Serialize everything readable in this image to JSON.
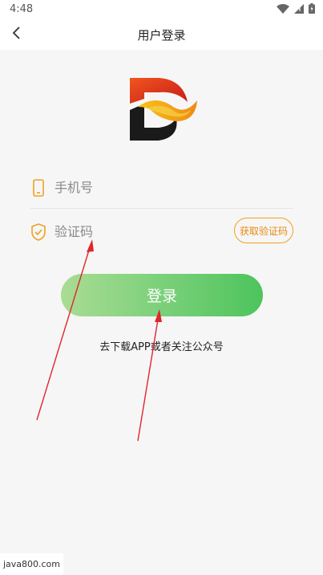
{
  "status_bar": {
    "time": "4:48",
    "icons": [
      "wifi-icon",
      "cellular-signal-icon",
      "battery-icon"
    ]
  },
  "app_bar": {
    "title": "用户登录",
    "back_icon": "chevron-left-icon"
  },
  "logo": {
    "letter": "D",
    "colors": [
      "#1a1a1a",
      "#d9261c",
      "#f5a11c"
    ]
  },
  "form": {
    "phone_placeholder": "手机号",
    "phone_value": "",
    "code_placeholder": "验证码",
    "code_value": "",
    "get_code_label": "获取验证码"
  },
  "login_button_label": "登录",
  "download_hint": "去下载APP或者关注公众号",
  "watermark": "java800.com",
  "colors": {
    "accent_orange": "#f0a020",
    "login_gradient_start": "#aadc94",
    "login_gradient_end": "#4dc45c",
    "annotation_arrow": "#e0262a"
  }
}
